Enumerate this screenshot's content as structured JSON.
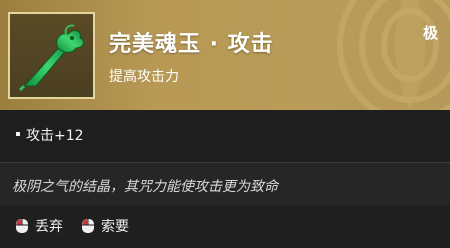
{
  "item": {
    "name": "完美魂玉 · 攻击",
    "subtitle": "提高攻击力",
    "grade": "极",
    "icon": "jade-sword-icon"
  },
  "stats": [
    {
      "text": "攻击+12"
    }
  ],
  "description": "极阴之气的结晶，其咒力能使攻击更为致命",
  "actions": [
    {
      "label": "丢弃",
      "icon": "mouse-icon"
    },
    {
      "label": "索要",
      "icon": "mouse-icon"
    }
  ],
  "colors": {
    "header_gold": "#b89a55",
    "frame_border": "#e7d49b",
    "jade_green": "#2fbf5c",
    "key_red": "#c8373d"
  }
}
